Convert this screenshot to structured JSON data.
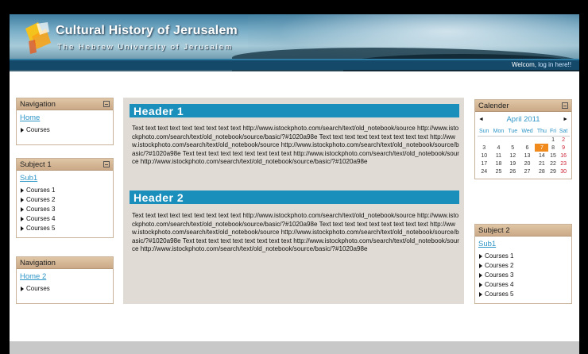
{
  "header": {
    "title": "Cultural History of Jerusalem",
    "subtitle": "The Hebrew University of Jerusalem",
    "welcome_text": "Welcom,",
    "login_link": "log in here!!"
  },
  "left_boxes": [
    {
      "title": "Navigation",
      "link": "Home",
      "items": [
        "Courses"
      ]
    },
    {
      "title": "Subject 1",
      "link": "Sub1",
      "items": [
        "Courses 1",
        "Courses 2",
        "Courses 3",
        "Courses 4",
        "Courses 5"
      ]
    },
    {
      "title": "Navigation",
      "link": "Home 2",
      "items": [
        "Courses"
      ]
    }
  ],
  "main": {
    "sections": [
      {
        "heading": "Header 1",
        "body": "Text text text text text text text text text http://www.istockphoto.com/search/text/old_notebook/source http://www.istockphoto.com/search/text/old_notebook/source/basic/?#1020a98e Text text text text text text text text text http://www.istockphoto.com/search/text/old_notebook/source http://www.istockphoto.com/search/text/old_notebook/source/basic/?#1020a98e Text text text text text text text text text http://www.istockphoto.com/search/text/old_notebook/source http://www.istockphoto.com/search/text/old_notebook/source/basic/?#1020a98e"
      },
      {
        "heading": "Header 2",
        "body": "Text text text text text text text text text http://www.istockphoto.com/search/text/old_notebook/source http://www.istockphoto.com/search/text/old_notebook/source/basic/?#1020a98e Text text text text text text text text text http://www.istockphoto.com/search/text/old_notebook/source http://www.istockphoto.com/search/text/old_notebook/source/basic/?#1020a98e Text text text text text text text text text http://www.istockphoto.com/search/text/old_notebook/source http://www.istockphoto.com/search/text/old_notebook/source/basic/?#1020a98e"
      }
    ]
  },
  "calendar": {
    "title": "Calender",
    "month": "April 2011",
    "prev": "◄",
    "next": "►",
    "weekdays": [
      "Sun",
      "Mon",
      "Tue",
      "Wed",
      "Thu",
      "Fri",
      "Sat"
    ],
    "weeks": [
      [
        "",
        "",
        "",
        "",
        "",
        "1",
        "2"
      ],
      [
        "3",
        "4",
        "5",
        "6",
        "7",
        "8",
        "9"
      ],
      [
        "10",
        "11",
        "12",
        "13",
        "14",
        "15",
        "16"
      ],
      [
        "17",
        "18",
        "19",
        "20",
        "21",
        "22",
        "23"
      ],
      [
        "24",
        "25",
        "26",
        "27",
        "28",
        "29",
        "30"
      ]
    ],
    "today": "7"
  },
  "right_box": {
    "title": "Subject 2",
    "link": "Sub1",
    "items": [
      "Courses 1",
      "Courses 2",
      "Courses 3",
      "Courses 4",
      "Courses 5"
    ]
  },
  "colors": {
    "accent": "#1b8fbc",
    "link": "#2e95c7",
    "box_header": "#d7bb99",
    "today": "#f08a1c"
  }
}
